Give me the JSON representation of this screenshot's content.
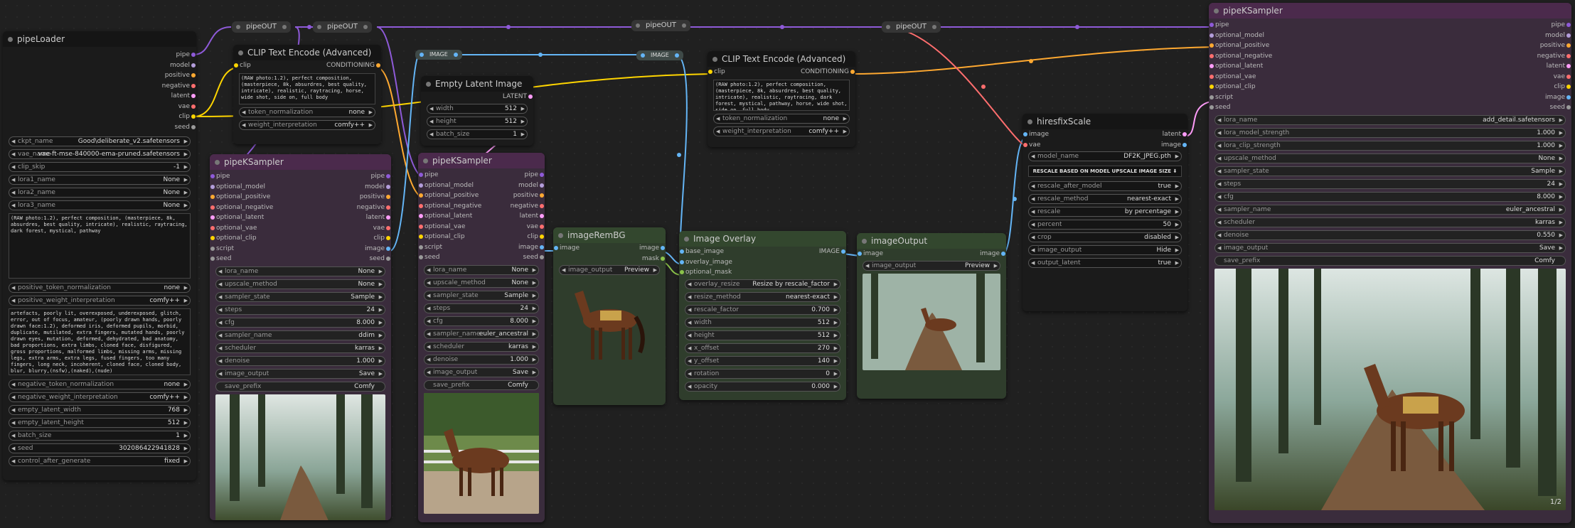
{
  "colors": {
    "pipe": "#8e5ad8",
    "model": "#b39ddb",
    "positive": "#ffa931",
    "negative": "#ff6e6e",
    "latent": "#ff9cf9",
    "vae": "#ff6e6e",
    "clip": "#ffd500",
    "seed": "#999999",
    "image": "#64b5f6",
    "conditioning": "#ffa931"
  },
  "pipeOut": {
    "label": "pipeOUT"
  },
  "image_label": "IMAGE",
  "pipeLoader": {
    "title": "pipeLoader",
    "outputs": [
      "pipe",
      "model",
      "positive",
      "negative",
      "latent",
      "vae",
      "clip",
      "seed"
    ],
    "widgets": [
      [
        "ckpt_name",
        "Good\\deliberate_v2.safetensors"
      ],
      [
        "vae_name",
        "vae-ft-mse-840000-ema-pruned.safetensors"
      ],
      [
        "clip_skip",
        "-1"
      ],
      [
        "lora1_name",
        "None"
      ],
      [
        "lora2_name",
        "None"
      ],
      [
        "lora3_name",
        "None"
      ]
    ],
    "positive_text": "(RAW photo:1.2), perfect composition, (masterpiece, 8k, absurdres, best quality, intricate), realistic, raytracing, dark forest, mystical, pathway",
    "widgets2": [
      [
        "positive_token_normalization",
        "none"
      ],
      [
        "positive_weight_interpretation",
        "comfy++"
      ]
    ],
    "negative_text": "artefacts, poorly lit, overexposed, underexposed, glitch, error, out of focus, amateur, (poorly drawn hands, poorly drawn face:1.2), deformed iris, deformed pupils, morbid, duplicate, mutilated, extra fingers, mutated hands, poorly drawn eyes, mutation, deformed, dehydrated, bad anatomy, bad proportions, extra limbs, cloned face, disfigured, gross proportions, malformed limbs, missing arms, missing legs, extra arms, extra legs, fused fingers, too many fingers, long neck, incoherent, cloned face, cloned body, blur, blurry,(nsfw),(naked),(nude)",
    "widgets3": [
      [
        "negative_token_normalization",
        "none"
      ],
      [
        "negative_weight_interpretation",
        "comfy++"
      ],
      [
        "empty_latent_width",
        "768"
      ],
      [
        "empty_latent_height",
        "512"
      ],
      [
        "batch_size",
        "1"
      ],
      [
        "seed",
        "302086422941828"
      ],
      [
        "control_after_generate",
        "fixed"
      ]
    ]
  },
  "clip1": {
    "title": "CLIP Text Encode (Advanced)",
    "in": "clip",
    "out": "CONDITIONING",
    "text": "(RAW photo:1.2), perfect composition, (masterpiece, 8k, absurdres, best quality, intricate), realistic, raytracing, horse, wide shot, side on, full body",
    "widgets": [
      [
        "token_normalization",
        "none"
      ],
      [
        "weight_interpretation",
        "comfy++"
      ]
    ]
  },
  "clip2": {
    "title": "CLIP Text Encode (Advanced)",
    "in": "clip",
    "out": "CONDITIONING",
    "text": "(RAW photo:1.2), perfect composition, (masterpiece, 8k, absurdres, best quality, intricate), realistic, raytracing, dark forest, mystical, pathway, horse, wide shot, side on, full body",
    "widgets": [
      [
        "token_normalization",
        "none"
      ],
      [
        "weight_interpretation",
        "comfy++"
      ]
    ]
  },
  "latent": {
    "title": "Empty Latent Image",
    "out": "LATENT",
    "widgets": [
      [
        "width",
        "512"
      ],
      [
        "height",
        "512"
      ],
      [
        "batch_size",
        "1"
      ]
    ]
  },
  "ks_inputs": [
    "pipe",
    "optional_model",
    "optional_positive",
    "optional_negative",
    "optional_latent",
    "optional_vae",
    "optional_clip",
    "script",
    "seed"
  ],
  "ks_outputs": [
    "pipe",
    "model",
    "positive",
    "negative",
    "latent",
    "vae",
    "clip",
    "image",
    "seed"
  ],
  "ks1": {
    "title": "pipeKSampler",
    "widgets": [
      [
        "lora_name",
        "None"
      ],
      [
        "upscale_method",
        "None"
      ],
      [
        "sampler_state",
        "Sample"
      ],
      [
        "steps",
        "24"
      ],
      [
        "cfg",
        "8.000"
      ],
      [
        "sampler_name",
        "ddim"
      ],
      [
        "scheduler",
        "karras"
      ],
      [
        "denoise",
        "1.000"
      ],
      [
        "image_output",
        "Save"
      ]
    ],
    "save": [
      "save_prefix",
      "Comfy"
    ]
  },
  "ks2": {
    "title": "pipeKSampler",
    "widgets": [
      [
        "lora_name",
        "None"
      ],
      [
        "upscale_method",
        "None"
      ],
      [
        "sampler_state",
        "Sample"
      ],
      [
        "steps",
        "24"
      ],
      [
        "cfg",
        "8.000"
      ],
      [
        "sampler_name",
        "euler_ancestral"
      ],
      [
        "scheduler",
        "karras"
      ],
      [
        "denoise",
        "1.000"
      ],
      [
        "image_output",
        "Save"
      ]
    ],
    "save": [
      "save_prefix",
      "Comfy"
    ]
  },
  "ks3": {
    "title": "pipeKSampler",
    "widgets": [
      [
        "lora_name",
        "add_detail.safetensors"
      ],
      [
        "lora_model_strength",
        "1.000"
      ],
      [
        "lora_clip_strength",
        "1.000"
      ],
      [
        "upscale_method",
        "None"
      ],
      [
        "sampler_state",
        "Sample"
      ],
      [
        "steps",
        "24"
      ],
      [
        "cfg",
        "8.000"
      ],
      [
        "sampler_name",
        "euler_ancestral"
      ],
      [
        "scheduler",
        "karras"
      ],
      [
        "denoise",
        "0.550"
      ],
      [
        "image_output",
        "Save"
      ]
    ],
    "save": [
      "save_prefix",
      "Comfy"
    ],
    "counter": "1/2",
    "close": "x"
  },
  "remBG": {
    "title": "imageRemBG",
    "in": "image",
    "outs": [
      "image",
      "mask"
    ],
    "widgets": [
      [
        "image_output",
        "Preview"
      ]
    ]
  },
  "overlay": {
    "title": "Image Overlay",
    "ins": [
      "base_image",
      "overlay_image",
      "optional_mask"
    ],
    "out": "IMAGE",
    "widgets": [
      [
        "overlay_resize",
        "Resize by rescale_factor"
      ],
      [
        "resize_method",
        "nearest-exact"
      ],
      [
        "rescale_factor",
        "0.700"
      ],
      [
        "width",
        "512"
      ],
      [
        "height",
        "512"
      ],
      [
        "x_offset",
        "270"
      ],
      [
        "y_offset",
        "140"
      ],
      [
        "rotation",
        "0"
      ],
      [
        "opacity",
        "0.000"
      ]
    ]
  },
  "imgOut": {
    "title": "imageOutput",
    "in": "image",
    "out": "image",
    "widgets": [
      [
        "image_output",
        "Preview"
      ]
    ]
  },
  "hires": {
    "title": "hiresfixScale",
    "ins": [
      "image",
      "vae"
    ],
    "outs": [
      "latent",
      "image"
    ],
    "widgets": [
      [
        "model_name",
        "DF2K_JPEG.pth"
      ]
    ],
    "banner": "RESCALE BASED ON MODEL UPSCALE IMAGE SIZE ⬇",
    "widgets2": [
      [
        "rescale_after_model",
        "true"
      ],
      [
        "rescale_method",
        "nearest-exact"
      ],
      [
        "rescale",
        "by percentage"
      ],
      [
        "percent",
        "50"
      ],
      [
        "crop",
        "disabled"
      ],
      [
        "image_output",
        "Hide"
      ],
      [
        "output_latent",
        "true"
      ]
    ]
  }
}
